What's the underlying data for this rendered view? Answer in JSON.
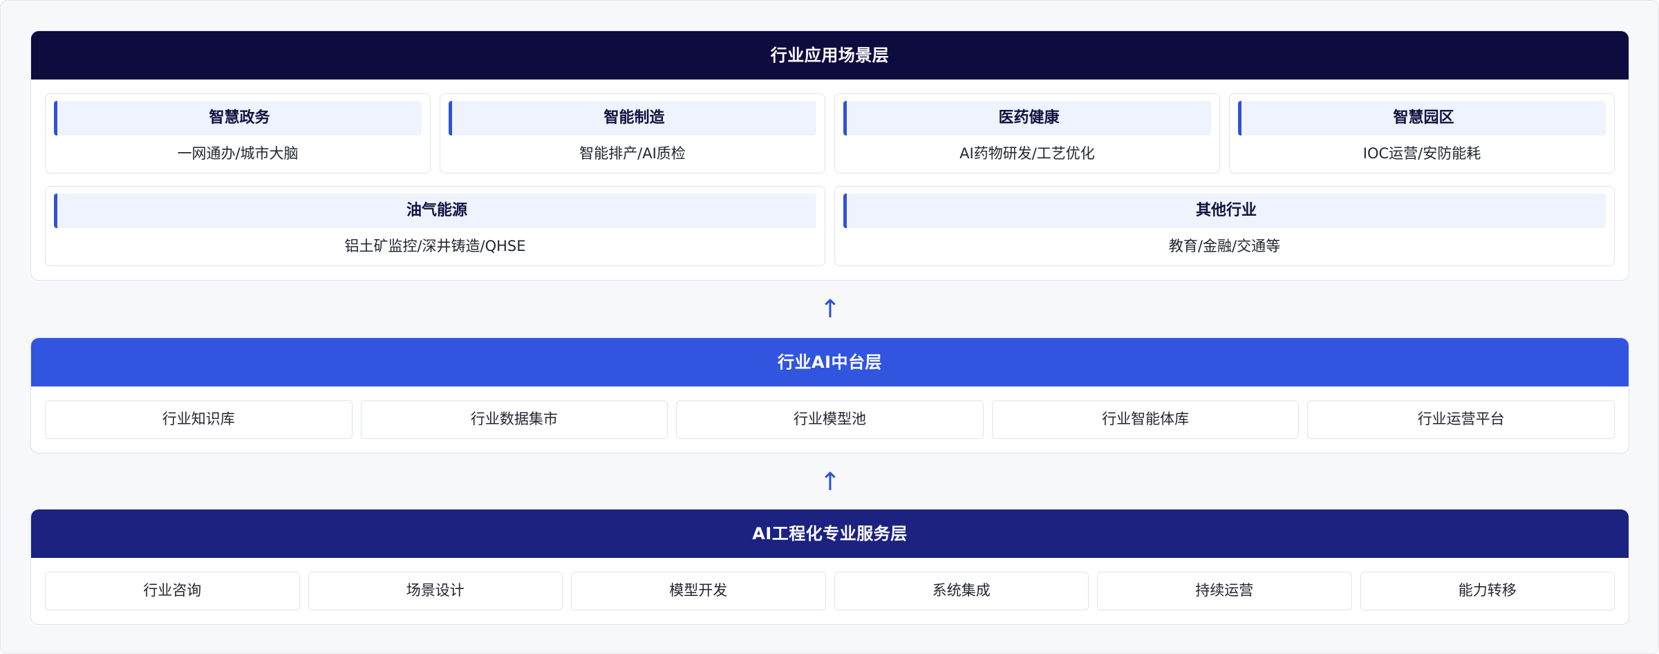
{
  "arrow_glyph": "↑",
  "layers": {
    "application": {
      "title": "行业应用场景层",
      "cards": [
        {
          "title": "智慧政务",
          "subtitle": "一网通办/城市大脑"
        },
        {
          "title": "智能制造",
          "subtitle": "智能排产/AI质检"
        },
        {
          "title": "医药健康",
          "subtitle": "AI药物研发/工艺优化"
        },
        {
          "title": "智慧园区",
          "subtitle": "IOC运营/安防能耗"
        },
        {
          "title": "油气能源",
          "subtitle": "铝土矿监控/深井铸造/QHSE"
        },
        {
          "title": "其他行业",
          "subtitle": "教育/金融/交通等"
        }
      ]
    },
    "platform": {
      "title": "行业AI中台层",
      "items": [
        "行业知识库",
        "行业数据集市",
        "行业模型池",
        "行业智能体库",
        "行业运营平台"
      ]
    },
    "service": {
      "title": "AI工程化专业服务层",
      "items": [
        "行业咨询",
        "场景设计",
        "模型开发",
        "系统集成",
        "持续运营",
        "能力转移"
      ]
    }
  },
  "colors": {
    "application_header": "#0e0b3f",
    "platform_header": "#3255e0",
    "service_header": "#1b2280",
    "card_accent": "#3152d6",
    "card_title_bg": "#eef3fd",
    "arrow": "#2e4fd6"
  }
}
